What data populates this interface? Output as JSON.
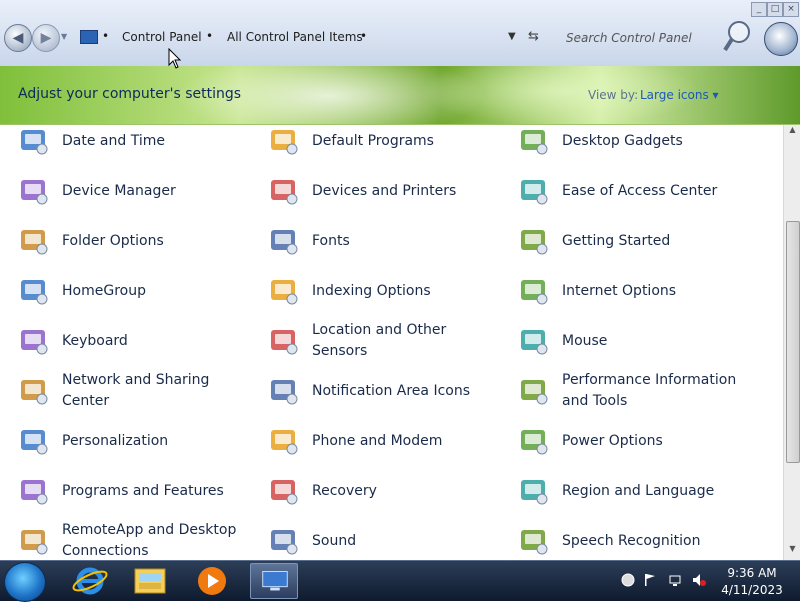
{
  "window": {
    "breadcrumb": [
      "Control Panel",
      "All Control Panel Items"
    ],
    "search_placeholder": "Search Control Panel",
    "banner_title": "Adjust your computer's settings",
    "view_by_label": "View by:",
    "view_by_value": "Large icons ▾"
  },
  "items": [
    {
      "label": "Date and Time",
      "icon": "date-time-icon"
    },
    {
      "label": "Default Programs",
      "icon": "default-programs-icon"
    },
    {
      "label": "Desktop Gadgets",
      "icon": "desktop-gadgets-icon"
    },
    {
      "label": "Device Manager",
      "icon": "device-manager-icon"
    },
    {
      "label": "Devices and Printers",
      "icon": "devices-printers-icon"
    },
    {
      "label": "Ease of Access Center",
      "icon": "ease-of-access-icon"
    },
    {
      "label": "Folder Options",
      "icon": "folder-options-icon"
    },
    {
      "label": "Fonts",
      "icon": "fonts-icon"
    },
    {
      "label": "Getting Started",
      "icon": "getting-started-icon"
    },
    {
      "label": "HomeGroup",
      "icon": "homegroup-icon"
    },
    {
      "label": "Indexing Options",
      "icon": "indexing-options-icon"
    },
    {
      "label": "Internet Options",
      "icon": "internet-options-icon"
    },
    {
      "label": "Keyboard",
      "icon": "keyboard-icon"
    },
    {
      "label": "Location and Other Sensors",
      "icon": "location-sensors-icon"
    },
    {
      "label": "Mouse",
      "icon": "mouse-icon"
    },
    {
      "label": "Network and Sharing Center",
      "icon": "network-sharing-icon"
    },
    {
      "label": "Notification Area Icons",
      "icon": "notification-area-icon"
    },
    {
      "label": "Performance Information and Tools",
      "icon": "performance-icon"
    },
    {
      "label": "Personalization",
      "icon": "personalization-icon"
    },
    {
      "label": "Phone and Modem",
      "icon": "phone-modem-icon"
    },
    {
      "label": "Power Options",
      "icon": "power-options-icon"
    },
    {
      "label": "Programs and Features",
      "icon": "programs-features-icon"
    },
    {
      "label": "Recovery",
      "icon": "recovery-icon"
    },
    {
      "label": "Region and Language",
      "icon": "region-language-icon"
    },
    {
      "label": "RemoteApp and Desktop Connections",
      "icon": "remoteapp-icon"
    },
    {
      "label": "Sound",
      "icon": "sound-icon"
    },
    {
      "label": "Speech Recognition",
      "icon": "speech-recognition-icon"
    }
  ],
  "taskbar": {
    "apps": [
      {
        "name": "internet-explorer-icon"
      },
      {
        "name": "windows-explorer-icon"
      },
      {
        "name": "media-player-icon"
      },
      {
        "name": "control-panel-icon",
        "active": true
      }
    ],
    "clock_time": "9:36 AM",
    "clock_date": "4/11/2023"
  }
}
